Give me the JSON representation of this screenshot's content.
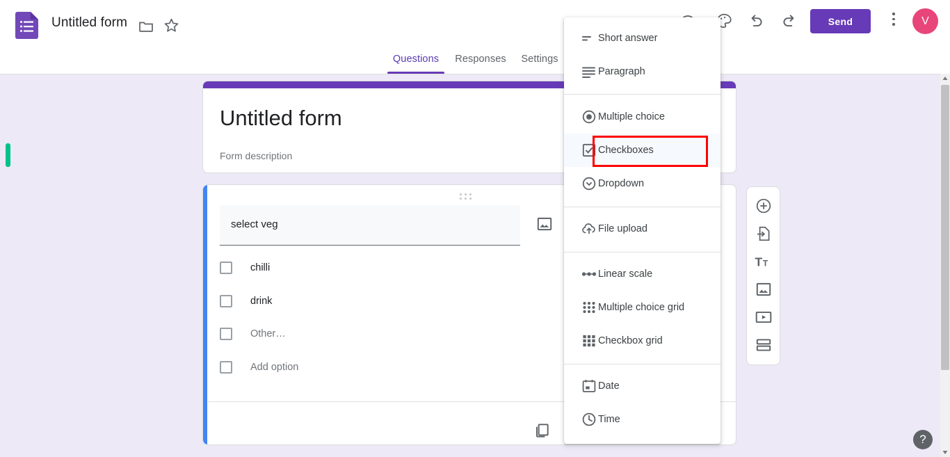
{
  "app": {
    "logo_icon": "google-forms-icon",
    "doc_title": "Untitled form",
    "folder_icon": "folder-icon",
    "star_icon": "star-icon"
  },
  "toolbar": {
    "preview_icon": "eye-preview-icon",
    "theme_icon": "palette-theme-icon",
    "undo_icon": "undo-icon",
    "redo_icon": "redo-icon",
    "send_label": "Send",
    "more_icon": "kebab-more-icon",
    "avatar_initial": "V",
    "avatar_color": "#e8457b",
    "send_color": "#673ab7"
  },
  "tabs": [
    {
      "label": "Questions",
      "active": true
    },
    {
      "label": "Responses",
      "active": false
    },
    {
      "label": "Settings",
      "active": false
    }
  ],
  "form_header": {
    "title": "Untitled form",
    "description": "Form description",
    "stripe_color": "#673ab7"
  },
  "question_card": {
    "accent_color": "#4285f4",
    "drag_handle_icon": "drag-handle-icon",
    "title": "select veg",
    "image_icon": "add-image-icon",
    "duplicate_icon": "duplicate-icon",
    "options": [
      {
        "label": "chilli",
        "muted": false
      },
      {
        "label": "drink",
        "muted": false
      },
      {
        "label": "Other…",
        "muted": true
      },
      {
        "label": "Add option",
        "muted": true
      }
    ]
  },
  "side_toolbar": [
    {
      "icon": "add-question-icon",
      "name": "add-question-button"
    },
    {
      "icon": "import-questions-icon",
      "name": "import-questions-button"
    },
    {
      "icon": "add-title-description-icon",
      "name": "add-title-description-button"
    },
    {
      "icon": "add-image-icon",
      "name": "add-image-button"
    },
    {
      "icon": "add-video-icon",
      "name": "add-video-button"
    },
    {
      "icon": "add-section-icon",
      "name": "add-section-button"
    }
  ],
  "type_menu": {
    "highlight_color": "#ff0000",
    "items": [
      {
        "label": "Short answer",
        "icon": "short-answer-icon",
        "hovered": false
      },
      {
        "label": "Paragraph",
        "icon": "paragraph-icon",
        "hovered": false
      },
      {
        "label": "Multiple choice",
        "icon": "radio-icon",
        "hovered": false
      },
      {
        "label": "Checkboxes",
        "icon": "checkbox-icon",
        "hovered": true
      },
      {
        "label": "Dropdown",
        "icon": "dropdown-icon",
        "hovered": false
      },
      {
        "label": "File upload",
        "icon": "file-upload-icon",
        "hovered": false
      },
      {
        "label": "Linear scale",
        "icon": "linear-scale-icon",
        "hovered": false
      },
      {
        "label": "Multiple choice grid",
        "icon": "radio-grid-icon",
        "hovered": false
      },
      {
        "label": "Checkbox grid",
        "icon": "checkbox-grid-icon",
        "hovered": false
      },
      {
        "label": "Date",
        "icon": "calendar-icon",
        "hovered": false
      },
      {
        "label": "Time",
        "icon": "clock-icon",
        "hovered": false
      }
    ]
  },
  "scrollbar": {
    "up_icon": "scroll-up-arrow-icon",
    "down_icon": "scroll-down-arrow-icon",
    "marker_color": "#00c389"
  },
  "help": {
    "label": "?"
  }
}
